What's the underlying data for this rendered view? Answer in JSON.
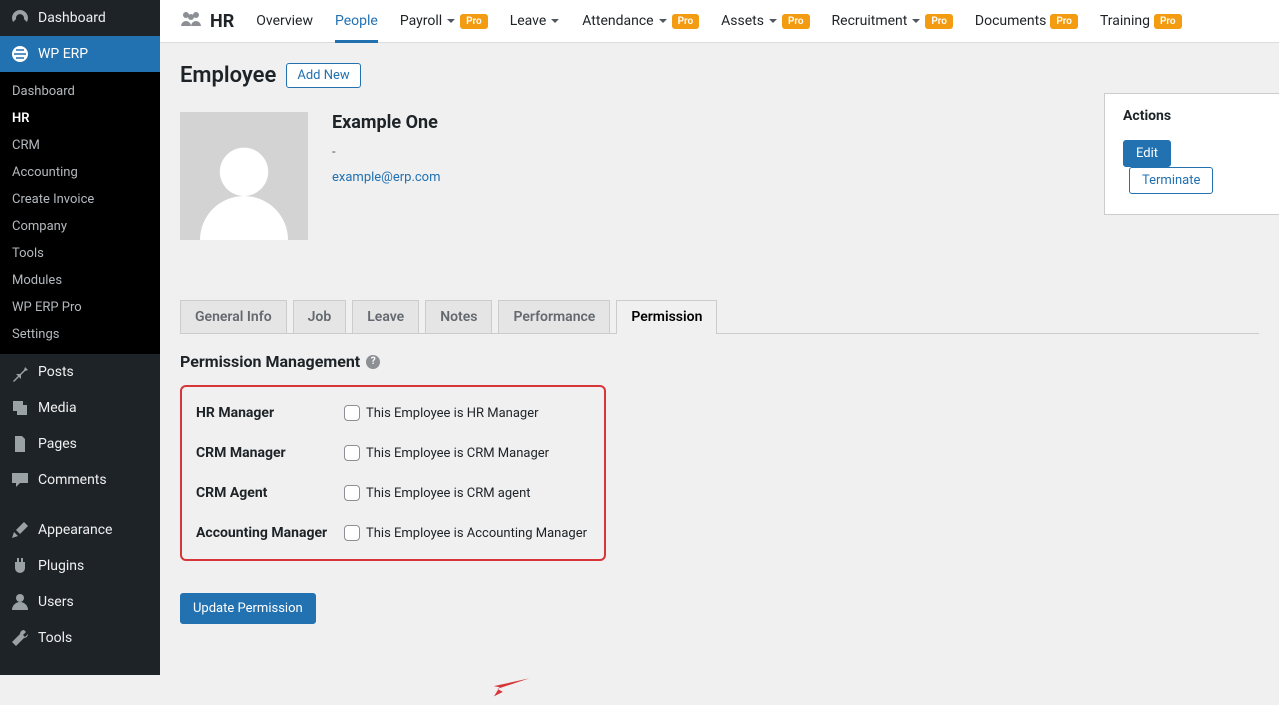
{
  "sidebar": {
    "dashboard": "Dashboard",
    "wperp": "WP ERP",
    "submenu": [
      "Dashboard",
      "HR",
      "CRM",
      "Accounting",
      "Create Invoice",
      "Company",
      "Tools",
      "Modules",
      "WP ERP Pro",
      "Settings"
    ],
    "items": [
      "Posts",
      "Media",
      "Pages",
      "Comments",
      "Appearance",
      "Plugins",
      "Users",
      "Tools"
    ]
  },
  "topbar": {
    "title": "HR",
    "nav": [
      {
        "label": "Overview",
        "pro": false,
        "chev": false
      },
      {
        "label": "People",
        "pro": false,
        "chev": false,
        "active": true
      },
      {
        "label": "Payroll",
        "pro": true,
        "chev": true
      },
      {
        "label": "Leave",
        "pro": false,
        "chev": true
      },
      {
        "label": "Attendance",
        "pro": true,
        "chev": true
      },
      {
        "label": "Assets",
        "pro": true,
        "chev": true
      },
      {
        "label": "Recruitment",
        "pro": true,
        "chev": true
      },
      {
        "label": "Documents",
        "pro": true,
        "chev": false
      },
      {
        "label": "Training",
        "pro": true,
        "chev": false
      }
    ],
    "pro_label": "Pro"
  },
  "page": {
    "title": "Employee",
    "add_new": "Add New"
  },
  "employee": {
    "name": "Example One",
    "dash": "-",
    "email": "example@erp.com"
  },
  "actions": {
    "title": "Actions",
    "edit": "Edit",
    "terminate": "Terminate"
  },
  "tabs": [
    "General Info",
    "Job",
    "Leave",
    "Notes",
    "Performance",
    "Permission"
  ],
  "perm": {
    "heading": "Permission Management",
    "rows": [
      {
        "label": "HR Manager",
        "text": "This Employee is HR Manager"
      },
      {
        "label": "CRM Manager",
        "text": "This Employee is CRM Manager"
      },
      {
        "label": "CRM Agent",
        "text": "This Employee is CRM agent"
      },
      {
        "label": "Accounting Manager",
        "text": "This Employee is Accounting Manager"
      }
    ],
    "button": "Update Permission"
  }
}
